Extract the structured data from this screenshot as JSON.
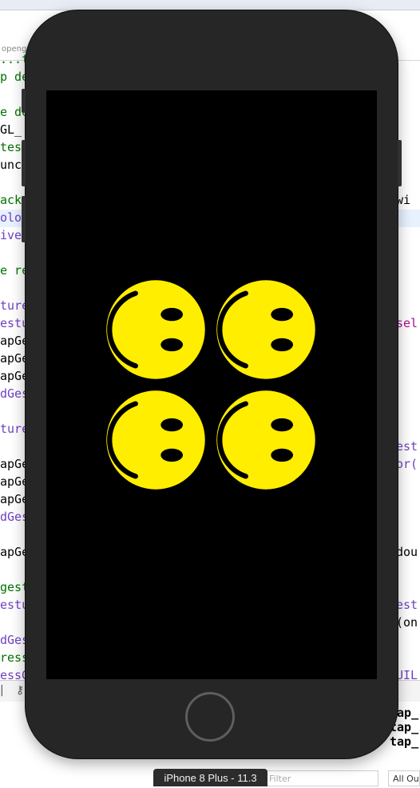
{
  "xcode": {
    "breadcrumb": "openg",
    "left_code": [
      {
        "text": "...text",
        "cls": "c-comment"
      },
      {
        "text": "p de",
        "cls": "c-comment"
      },
      {
        "text": "",
        "cls": "c-plain"
      },
      {
        "text": "e de",
        "cls": "c-comment"
      },
      {
        "text": "GL_",
        "cls": "c-plain"
      },
      {
        "text": "tes",
        "cls": "c-comment"
      },
      {
        "text": "unc",
        "cls": "c-plain"
      },
      {
        "text": "",
        "cls": "c-plain"
      },
      {
        "text": "ackg",
        "cls": "c-comment"
      },
      {
        "text": "olo",
        "cls": "c-purple"
      },
      {
        "text": "ive",
        "cls": "c-purple"
      },
      {
        "text": "",
        "cls": "c-plain"
      },
      {
        "text": "e re",
        "cls": "c-comment"
      },
      {
        "text": "",
        "cls": "c-plain"
      },
      {
        "text": "ture",
        "cls": "c-purple"
      },
      {
        "text": "estu",
        "cls": "c-purple"
      },
      {
        "text": "apGe",
        "cls": "c-plain"
      },
      {
        "text": "apGe",
        "cls": "c-plain"
      },
      {
        "text": "apGe",
        "cls": "c-plain"
      },
      {
        "text": "dGes",
        "cls": "c-purple"
      },
      {
        "text": "",
        "cls": "c-plain"
      },
      {
        "text": "ture",
        "cls": "c-purple"
      },
      {
        "text": "",
        "cls": "c-plain"
      },
      {
        "text": "apGe",
        "cls": "c-plain"
      },
      {
        "text": "apGe",
        "cls": "c-plain"
      },
      {
        "text": "apGe",
        "cls": "c-plain"
      },
      {
        "text": "dGes",
        "cls": "c-purple"
      },
      {
        "text": "",
        "cls": "c-plain"
      },
      {
        "text": "apGe",
        "cls": "c-plain"
      },
      {
        "text": "",
        "cls": "c-plain"
      },
      {
        "text": "gest",
        "cls": "c-comment"
      },
      {
        "text": "estu",
        "cls": "c-purple"
      },
      {
        "text": "",
        "cls": "c-plain"
      },
      {
        "text": "dGes",
        "cls": "c-purple"
      },
      {
        "text": "ress",
        "cls": "c-comment"
      },
      {
        "text": "essG",
        "cls": "c-purple"
      }
    ],
    "right_code": [
      {
        "row": 8,
        "text": " wi",
        "cls": "c-plain"
      },
      {
        "row": 15,
        "text": "sel",
        "cls": "c-keyword"
      },
      {
        "row": 22,
        "text": "est",
        "cls": "c-purple"
      },
      {
        "row": 23,
        "text": "or(",
        "cls": "c-purple"
      },
      {
        "row": 28,
        "text": "dou",
        "cls": "c-plain"
      },
      {
        "row": 31,
        "text": "est",
        "cls": "c-purple"
      },
      {
        "row": 32,
        "text": "(on",
        "cls": "c-plain"
      },
      {
        "row": 35,
        "text": "UIL",
        "cls": "c-purple"
      }
    ],
    "console_lines": [
      "tap_",
      "tap_",
      "tap_"
    ],
    "filter_placeholder": "Filter",
    "output_selector": "All Output"
  },
  "simulator": {
    "device_label": "iPhone 8 Plus - 11.3",
    "screen_color": "#000000",
    "smiley_color": "#ffee00",
    "smiley_count": 4
  }
}
